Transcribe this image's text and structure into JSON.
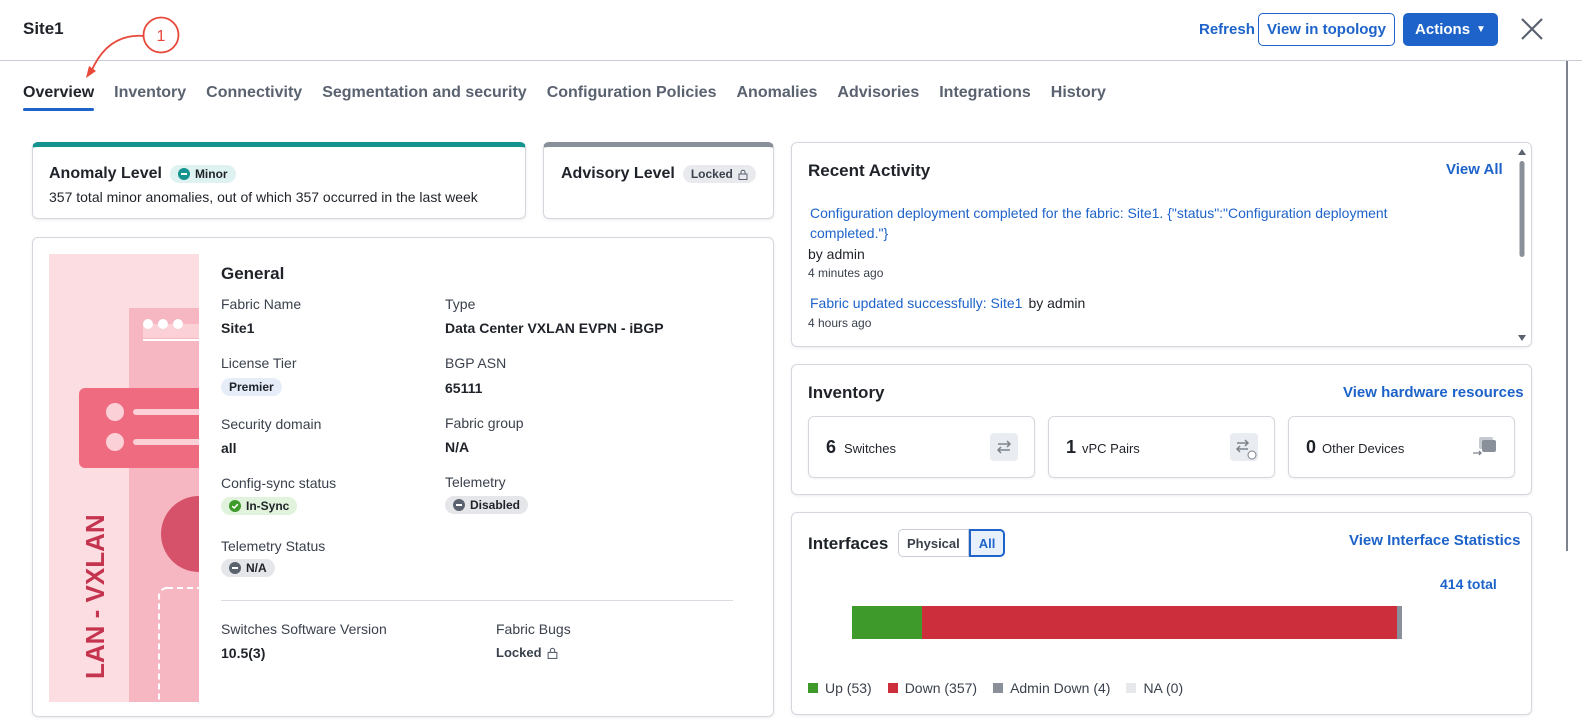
{
  "header": {
    "title": "Site1",
    "refresh_label": "Refresh",
    "topology_label": "View in topology",
    "actions_label": "Actions"
  },
  "annotation": {
    "number": "1"
  },
  "tabs": [
    {
      "label": "Overview",
      "active": true
    },
    {
      "label": "Inventory"
    },
    {
      "label": "Connectivity"
    },
    {
      "label": "Segmentation and security"
    },
    {
      "label": "Configuration Policies"
    },
    {
      "label": "Anomalies"
    },
    {
      "label": "Advisories"
    },
    {
      "label": "Integrations"
    },
    {
      "label": "History"
    }
  ],
  "anomaly": {
    "title": "Anomaly Level",
    "badge": "Minor",
    "description": "357 total minor anomalies, out of which 357 occurred in the last week",
    "accent": "#15938f"
  },
  "advisory": {
    "title": "Advisory Level",
    "badge": "Locked"
  },
  "general": {
    "illustration_text": "LAN - VXLAN",
    "title": "General",
    "fabric_name_label": "Fabric Name",
    "fabric_name": "Site1",
    "type_label": "Type",
    "type": "Data Center VXLAN EVPN - iBGP",
    "license_tier_label": "License Tier",
    "license_tier": "Premier",
    "bgp_asn_label": "BGP ASN",
    "bgp_asn": "65111",
    "security_domain_label": "Security domain",
    "security_domain": "all",
    "fabric_group_label": "Fabric group",
    "fabric_group": "N/A",
    "config_sync_label": "Config-sync status",
    "config_sync": "In-Sync",
    "telemetry_label": "Telemetry",
    "telemetry": "Disabled",
    "telemetry_status_label": "Telemetry Status",
    "telemetry_status": "N/A",
    "sw_version_label": "Switches Software Version",
    "sw_version": "10.5(3)",
    "fabric_bugs_label": "Fabric Bugs",
    "fabric_bugs": "Locked"
  },
  "recent_activity": {
    "title": "Recent Activity",
    "view_all": "View All",
    "items": [
      {
        "text": "Configuration deployment completed for the fabric: Site1. {\"status\":\"Configuration deployment completed.\"}",
        "by": "by admin",
        "time": "4 minutes ago"
      },
      {
        "text": "Fabric updated successfully: Site1",
        "by": "by admin",
        "time": "4 hours ago"
      }
    ]
  },
  "inventory": {
    "title": "Inventory",
    "view_link": "View hardware resources",
    "tiles": [
      {
        "count": "6",
        "label": "Switches",
        "icon": "switch-icon"
      },
      {
        "count": "1",
        "label": "vPC Pairs",
        "icon": "vpc-pair-icon"
      },
      {
        "count": "0",
        "label": "Other Devices",
        "icon": "other-devices-icon"
      }
    ]
  },
  "interfaces": {
    "title": "Interfaces",
    "toggle_options": [
      "Physical",
      "All"
    ],
    "selected": "All",
    "view_link": "View Interface Statistics",
    "total": "414 total",
    "segments": [
      {
        "label": "Up (53)",
        "value": 53,
        "color": "#3e9a2b"
      },
      {
        "label": "Down (357)",
        "value": 357,
        "color": "#cc2f3b"
      },
      {
        "label": "Admin Down (4)",
        "value": 4,
        "color": "#8a9099"
      },
      {
        "label": "NA (0)",
        "value": 0,
        "color": "#e6e8eb"
      }
    ]
  }
}
